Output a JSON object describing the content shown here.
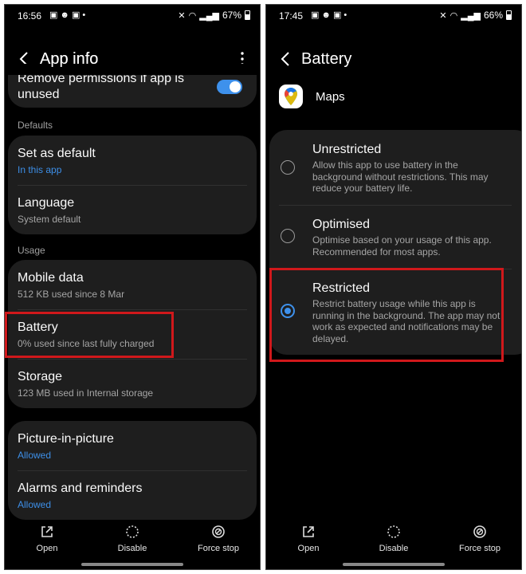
{
  "left": {
    "status": {
      "time": "16:56",
      "battery": "67%"
    },
    "appbar": {
      "title": "App info"
    },
    "partial_row": {
      "title_line1": "Remove permissions if app is",
      "title_line2": "unused"
    },
    "sections": {
      "defaults": "Defaults",
      "usage": "Usage"
    },
    "defaults_items": [
      {
        "title": "Set as default",
        "subtitle": "In this app"
      },
      {
        "title": "Language",
        "subtitle": "System default"
      }
    ],
    "usage_items": [
      {
        "title": "Mobile data",
        "subtitle": "512 KB used since 8 Mar"
      },
      {
        "title": "Battery",
        "subtitle": "0% used since last fully charged"
      },
      {
        "title": "Storage",
        "subtitle": "123 MB used in Internal storage"
      }
    ],
    "other_items": [
      {
        "title": "Picture-in-picture",
        "subtitle": "Allowed"
      },
      {
        "title": "Alarms and reminders",
        "subtitle": "Allowed"
      }
    ],
    "nav": {
      "open": "Open",
      "disable": "Disable",
      "force_stop": "Force stop"
    }
  },
  "right": {
    "status": {
      "time": "17:45",
      "battery": "66%"
    },
    "appbar": {
      "title": "Battery"
    },
    "app": {
      "name": "Maps"
    },
    "options": [
      {
        "title": "Unrestricted",
        "desc": "Allow this app to use battery in the background without restrictions. This may reduce your battery life.",
        "selected": false
      },
      {
        "title": "Optimised",
        "desc": "Optimise based on your usage of this app. Recommended for most apps.",
        "selected": false
      },
      {
        "title": "Restricted",
        "desc": "Restrict battery usage while this app is running in the background. The app may not work as expected and notifications may be delayed.",
        "selected": true
      }
    ],
    "nav": {
      "open": "Open",
      "disable": "Disable",
      "force_stop": "Force stop"
    }
  },
  "colors": {
    "accent": "#3e91ec",
    "highlight": "#d0181b",
    "card": "#1e1e1e",
    "background": "#000000"
  }
}
